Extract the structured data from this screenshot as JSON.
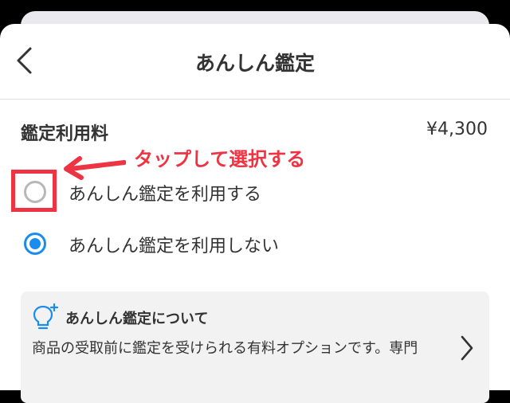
{
  "header": {
    "title": "あんしん鑑定",
    "back_icon": "chevron-left-icon"
  },
  "fee": {
    "label": "鑑定利用料",
    "value": "¥4,300"
  },
  "annotation": {
    "text": "タップして選択する",
    "color": "#ee3342"
  },
  "options": [
    {
      "label": "あんしん鑑定を利用する",
      "selected": false
    },
    {
      "label": "あんしん鑑定を利用しない",
      "selected": true
    }
  ],
  "info": {
    "icon": "lightbulb-icon",
    "title": "あんしん鑑定について",
    "description": "商品の受取前に鑑定を受けられる有料オプションです。専門",
    "chevron_icon": "chevron-right-icon"
  },
  "colors": {
    "accent": "#1a8cf0",
    "annotation": "#ee3342",
    "card_background": "#f2f2f2"
  }
}
